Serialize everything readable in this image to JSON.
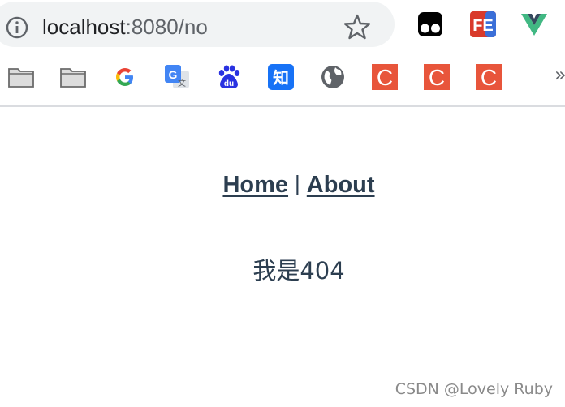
{
  "browser": {
    "url_host": "localhost",
    "url_rest": ":8080/no",
    "extensions": [
      {
        "icon": "tampermonkey-extension-icon"
      },
      {
        "icon": "fe-helper-extension-icon",
        "label": "FE"
      },
      {
        "icon": "vue-devtools-extension-icon"
      }
    ],
    "bookmarks": [
      {
        "icon": "folder-icon"
      },
      {
        "icon": "folder-icon"
      },
      {
        "icon": "google-icon",
        "label": "G"
      },
      {
        "icon": "google-translate-icon",
        "label": "G"
      },
      {
        "icon": "baidu-icon",
        "label": "du"
      },
      {
        "icon": "zhihu-icon",
        "label": "知"
      },
      {
        "icon": "globe-icon"
      },
      {
        "icon": "csdn-icon",
        "label": "C"
      },
      {
        "icon": "csdn-icon",
        "label": "C"
      },
      {
        "icon": "csdn-icon",
        "label": "C"
      }
    ],
    "more_bookmarks": "»"
  },
  "page": {
    "nav": {
      "home": "Home",
      "separator": "|",
      "about": "About"
    },
    "message": "我是404"
  },
  "watermark": "CSDN @Lovely Ruby",
  "colors": {
    "text": "#2c3e50",
    "csdn": "#e8553b",
    "zhihu": "#1772f6",
    "baidu": "#2932e1"
  }
}
